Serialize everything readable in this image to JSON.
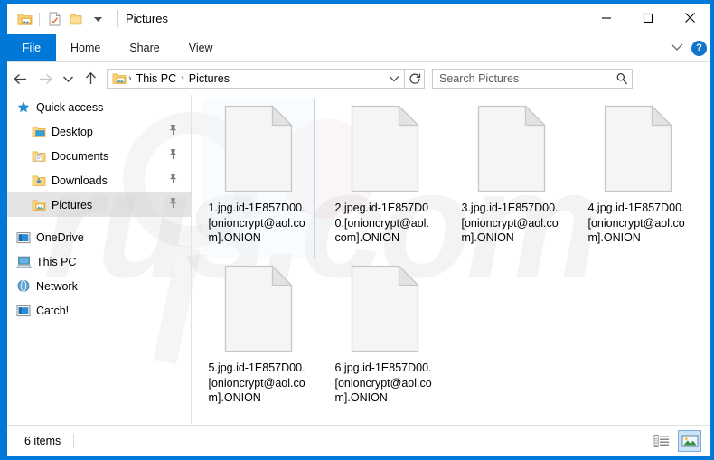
{
  "window": {
    "title": "Pictures",
    "border_color": "#0078d7",
    "accent_color": "#0078d7",
    "quick_access_toolbar": [
      {
        "name": "pictures-folder-icon",
        "label": "Pictures folder"
      },
      {
        "name": "properties-icon",
        "label": "Properties"
      },
      {
        "name": "new-folder-icon",
        "label": "New folder"
      },
      {
        "name": "customize-qat-caret",
        "label": "Customize Quick Access Toolbar"
      }
    ],
    "controls": {
      "minimize": "—",
      "maximize": "□",
      "close": "✕"
    }
  },
  "ribbon": {
    "tabs": [
      {
        "label": "File",
        "active": true
      },
      {
        "label": "Home",
        "active": false
      },
      {
        "label": "Share",
        "active": false
      },
      {
        "label": "View",
        "active": false
      }
    ],
    "collapse_caret": "⌄",
    "help_label": "?"
  },
  "address": {
    "back_label": "Back",
    "forward_label": "Forward",
    "recent_label": "Recent locations",
    "up_label": "Up",
    "breadcrumbs": [
      "This PC",
      "Pictures"
    ],
    "separator": "›",
    "refresh_label": "Refresh"
  },
  "search": {
    "placeholder": "Search Pictures",
    "value": ""
  },
  "sidebar": {
    "items": [
      {
        "label": "Quick access",
        "icon": "star-icon",
        "indent": false,
        "pinned": false,
        "selected": false
      },
      {
        "label": "Desktop",
        "icon": "desktop-folder-icon",
        "indent": true,
        "pinned": true,
        "selected": false
      },
      {
        "label": "Documents",
        "icon": "documents-folder-icon",
        "indent": true,
        "pinned": true,
        "selected": false
      },
      {
        "label": "Downloads",
        "icon": "downloads-folder-icon",
        "indent": true,
        "pinned": true,
        "selected": false
      },
      {
        "label": "Pictures",
        "icon": "pictures-folder-icon",
        "indent": true,
        "pinned": true,
        "selected": true
      },
      {
        "label": "OneDrive",
        "icon": "onedrive-icon",
        "indent": false,
        "pinned": false,
        "selected": false
      },
      {
        "label": "This PC",
        "icon": "this-pc-icon",
        "indent": false,
        "pinned": false,
        "selected": false
      },
      {
        "label": "Network",
        "icon": "network-icon",
        "indent": false,
        "pinned": false,
        "selected": false
      },
      {
        "label": "Catch!",
        "icon": "catch-icon",
        "indent": false,
        "pinned": false,
        "selected": false
      }
    ]
  },
  "files": {
    "icon_type": "blank-file-icon",
    "items": [
      {
        "name": "1.jpg.id-1E857D00.[onioncrypt@aol.com].ONION",
        "selected": true
      },
      {
        "name": "2.jpeg.id-1E857D00.[onioncrypt@aol.com].ONION",
        "selected": false
      },
      {
        "name": "3.jpg.id-1E857D00.[onioncrypt@aol.com].ONION",
        "selected": false
      },
      {
        "name": "4.jpg.id-1E857D00.[onioncrypt@aol.com].ONION",
        "selected": false
      },
      {
        "name": "5.jpg.id-1E857D00.[onioncrypt@aol.com].ONION",
        "selected": false
      },
      {
        "name": "6.jpg.id-1E857D00.[onioncrypt@aol.com].ONION",
        "selected": false
      }
    ]
  },
  "status": {
    "item_count": "6 items",
    "views": [
      {
        "name": "details-view-button",
        "label": "Details view",
        "active": false
      },
      {
        "name": "large-icons-view-button",
        "label": "Large icons view",
        "active": true
      }
    ]
  }
}
